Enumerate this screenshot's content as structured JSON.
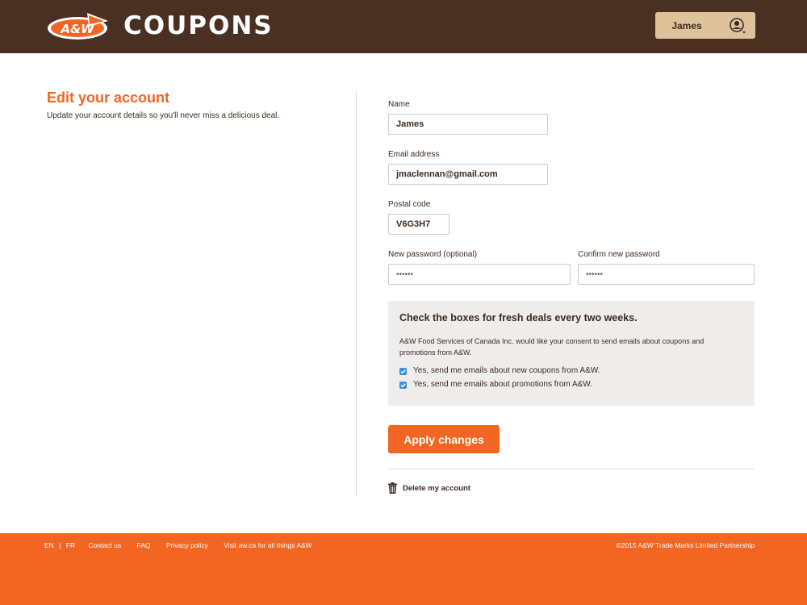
{
  "header": {
    "logo_text": "A&W",
    "title": "COUPONS",
    "user_name": "James",
    "user_icon": "user-circle-icon",
    "colors": {
      "bar": "#4a2f23",
      "user_menu": "#dec39a",
      "logo_orange": "#f26522"
    }
  },
  "intro": {
    "title": "Edit your account",
    "subtitle": "Update your account details so you'll never miss a delicious deal."
  },
  "form": {
    "name_label": "Name",
    "name_value": "James",
    "email_label": "Email address",
    "email_value": "jmaclennan@gmail.com",
    "postal_label": "Postal code",
    "postal_value": "V6G3H7",
    "new_password_label": "New password (optional)",
    "new_password_value": "••••••",
    "confirm_password_label": "Confirm new password",
    "confirm_password_value": "••••••"
  },
  "consent": {
    "title": "Check the boxes for fresh deals every two weeks.",
    "text": "A&W Food Services of Canada Inc. would like your consent to send emails about coupons and promotions from A&W.",
    "options": [
      {
        "label": "Yes, send me emails about new coupons from A&W.",
        "checked": true
      },
      {
        "label": "Yes, send me emails about promotions from A&W.",
        "checked": true
      }
    ]
  },
  "actions": {
    "apply_label": "Apply changes",
    "delete_label": "Delete my account",
    "delete_icon": "trash-icon"
  },
  "footer": {
    "lang_en": "EN",
    "lang_sep": "|",
    "lang_fr": "FR",
    "contact": "Contact us",
    "faq": "FAQ",
    "privacy": "Privacy policy",
    "visit": "Visit aw.ca for all things A&W",
    "copyright": "©2015 A&W Trade Marks Limited Partnership",
    "color": "#f26522"
  }
}
